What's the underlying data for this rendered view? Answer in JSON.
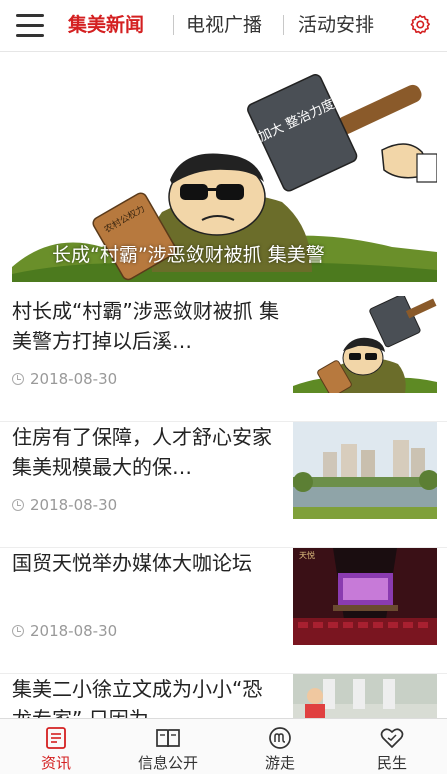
{
  "header": {
    "tabs": [
      {
        "label": "集美新闻",
        "active": true
      },
      {
        "label": "电视广播",
        "active": false
      },
      {
        "label": "活动安排",
        "active": false
      }
    ]
  },
  "banner": {
    "caption": "长成“村霸”涉恶敛财被抓 集美警",
    "sign_text": "加大 整治力度",
    "board_text": "农村公权力"
  },
  "news": [
    {
      "title": "村长成“村霸”涉恶敛财被抓 集美警方打掉以后溪…",
      "date": "2018-08-30"
    },
    {
      "title": "住房有了保障，人才舒心安家 集美规模最大的保…",
      "date": "2018-08-30"
    },
    {
      "title": "国贸天悦举办媒体大咖论坛",
      "date": "2018-08-30"
    },
    {
      "title": "集美二小徐立文成为小小“恐龙专家” 只因为…",
      "date": ""
    }
  ],
  "thumb3_text": "天悦",
  "bottom_nav": [
    {
      "label": "资讯",
      "icon": "news-icon",
      "active": true
    },
    {
      "label": "信息公开",
      "icon": "book-icon",
      "active": false
    },
    {
      "label": "游走",
      "icon": "walk-icon",
      "active": false
    },
    {
      "label": "民生",
      "icon": "heart-icon",
      "active": false
    }
  ],
  "colors": {
    "accent": "#d42021",
    "text": "#222222",
    "muted": "#999999"
  }
}
